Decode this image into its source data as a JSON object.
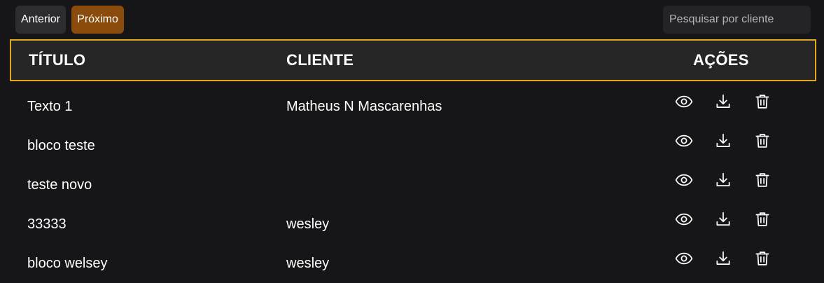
{
  "pagination": {
    "prev_label": "Anterior",
    "next_label": "Próximo"
  },
  "search": {
    "placeholder": "Pesquisar por cliente",
    "value": ""
  },
  "table": {
    "headers": {
      "title": "TÍTULO",
      "client": "CLIENTE",
      "actions": "AÇÕES"
    },
    "rows": [
      {
        "title": "Texto 1",
        "client": "Matheus N Mascarenhas"
      },
      {
        "title": "bloco teste",
        "client": ""
      },
      {
        "title": "teste novo",
        "client": ""
      },
      {
        "title": "33333",
        "client": "wesley"
      },
      {
        "title": "bloco welsey",
        "client": "wesley"
      }
    ],
    "row_actions": [
      "eye-icon",
      "download-icon",
      "trash-icon"
    ]
  },
  "colors": {
    "background": "#161517",
    "header_border": "#e0a81f",
    "header_bg": "#262627",
    "prev_button": "#2c2c31",
    "next_button": "#8a4b0c",
    "search_bg": "#242326"
  }
}
